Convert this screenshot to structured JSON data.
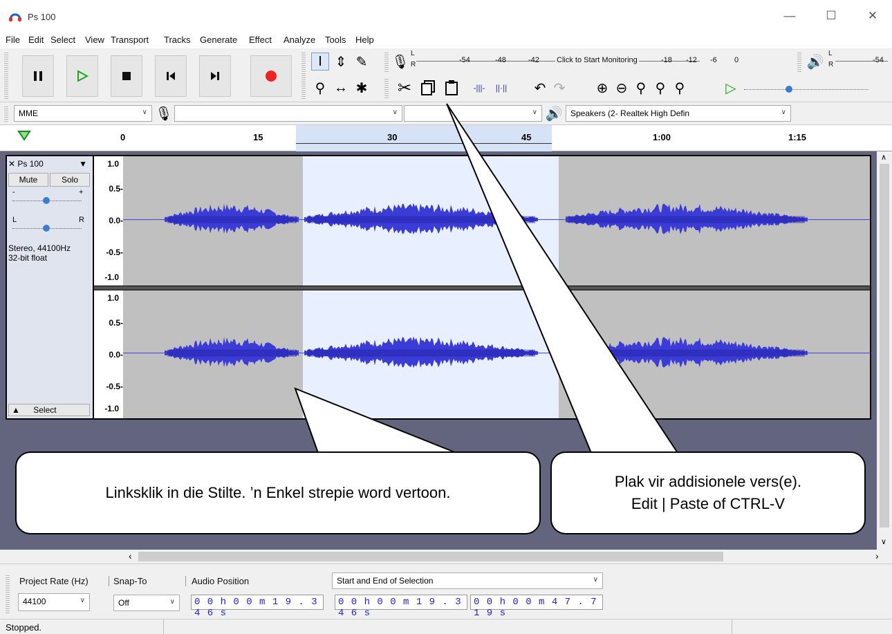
{
  "window": {
    "title": "Ps 100",
    "minimize": "—",
    "maximize": "☐",
    "close": "✕"
  },
  "menu": [
    "File",
    "Edit",
    "Select",
    "View",
    "Transport",
    "Tracks",
    "Generate",
    "Effect",
    "Analyze",
    "Tools",
    "Help"
  ],
  "transport": [
    "pause",
    "play",
    "stop",
    "skip-start",
    "skip-end",
    "record"
  ],
  "meter": {
    "rec_ticks": [
      "-54",
      "-48",
      "-42",
      "Click to Start Monitoring",
      "-18",
      "-12",
      "-6",
      "0"
    ],
    "play_ticks": [
      "-54"
    ],
    "lr_top": "L",
    "lr_bottom": "R"
  },
  "devices": {
    "host": "MME",
    "mic": "",
    "channels": "",
    "speaker": "Speakers (2- Realtek High Defin"
  },
  "timeline": {
    "ticks": [
      "0",
      "15",
      "30",
      "45",
      "1:00",
      "1:15"
    ]
  },
  "track": {
    "name": "Ps 100",
    "mute": "Mute",
    "solo": "Solo",
    "gain_minus": "-",
    "gain_plus": "+",
    "pan_l": "L",
    "pan_r": "R",
    "info1": "Stereo, 44100Hz",
    "info2": "32-bit float",
    "select": "Select",
    "scale_top": [
      "1.0",
      "0.5-",
      "0.0-",
      "-0.5-",
      "-1.0"
    ],
    "scale_bottom": [
      "1.0",
      "0.5-",
      "0.0-",
      "-0.5-",
      "-1.0"
    ]
  },
  "callouts": {
    "left": "Linksklik in die Stilte. ’n Enkel strepie word vertoon.",
    "right_line1": "Plak vir addisionele vers(e).",
    "right_line2": "Edit | Paste of CTRL-V"
  },
  "selection": {
    "project_rate_label": "Project Rate (Hz)",
    "project_rate": "44100",
    "snap_label": "Snap-To",
    "snap_value": "Off",
    "audio_pos_label": "Audio Position",
    "audio_pos": "0 0 h 0 0 m 1 9 . 3 4 6 s",
    "sel_mode": "Start and End of Selection",
    "sel_start": "0 0 h 0 0 m 1 9 . 3 4 6 s",
    "sel_end": "0 0 h 0 0 m 4 7 . 7 1 9 s"
  },
  "status": "Stopped.",
  "colors": {
    "wave": "#3b3bd6",
    "wave_dark": "#2323a8",
    "selection": "#e8f0ff",
    "unselected": "#c0c0c0",
    "bg": "#63657f"
  }
}
